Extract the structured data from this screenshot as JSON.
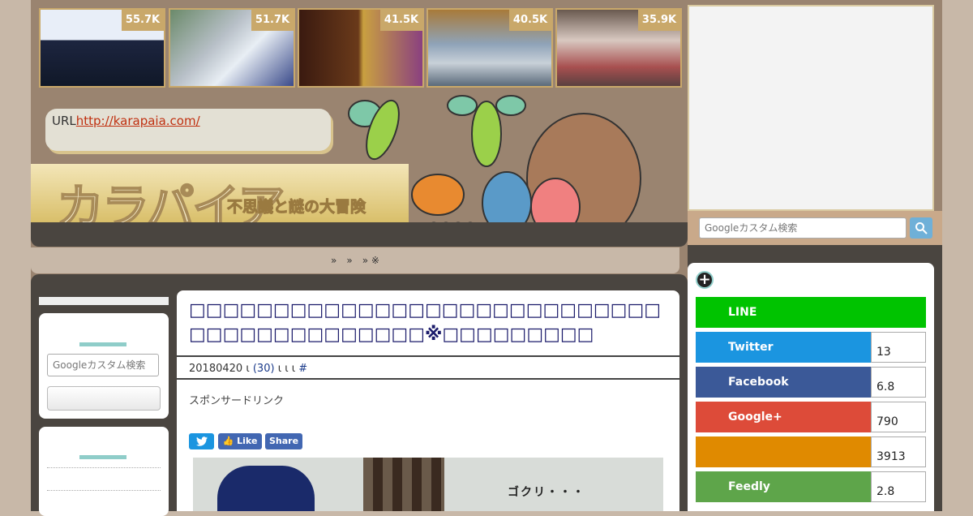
{
  "header": {
    "thumbnails": [
      {
        "count": "55.7K",
        "color": "#1d2540"
      },
      {
        "count": "51.7K",
        "color": "#9aa3ab"
      },
      {
        "count": "41.5K",
        "color": "#6a3a1a"
      },
      {
        "count": "40.5K",
        "color": "#8fa3b8"
      },
      {
        "count": "35.9K",
        "color": "#8a6050"
      }
    ],
    "url_label": "URL",
    "url_link": "http://karapaia.com/",
    "logo": "カラパイア",
    "tagline": "不思議と謎の大冒険"
  },
  "breadcrumb": "»　»　» ※",
  "article": {
    "title": "□□□□□□□□□□□□□□□□□□□□□□□□□□□□□□□□□□□□□□□□□□※□□□□□□□□□",
    "date": "20180420",
    "sep1": "ι",
    "comments": "(30)",
    "sep2": "ι ι ι",
    "hash": "#",
    "sponsor": "スポンサードリンク",
    "share_like": "Like",
    "share_share": "Share",
    "image_caption": "ゴクリ・・・"
  },
  "sidebar_left": {
    "search_placeholder": "Googleカスタム検索"
  },
  "sidebar_right": {
    "search_placeholder": "Googleカスタム検索",
    "social": [
      {
        "label": "LINE",
        "count": "",
        "color": "#00c300"
      },
      {
        "label": "Twitter",
        "count": "13",
        "color": "#1b95e0"
      },
      {
        "label": "Facebook",
        "count": "6.8",
        "color": "#3b5998"
      },
      {
        "label": "Google+",
        "count": "790",
        "color": "#dd4b39"
      },
      {
        "label": "",
        "count": "3913",
        "color": "#e08a00"
      },
      {
        "label": "Feedly",
        "count": "2.8",
        "color": "#5ea54a"
      }
    ]
  }
}
